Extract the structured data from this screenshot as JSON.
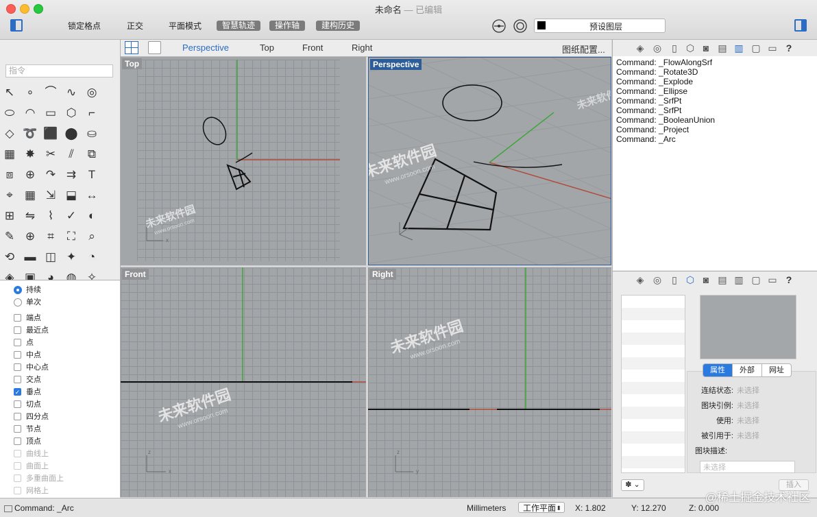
{
  "window": {
    "title": "未命名",
    "subtitle": "— 已编辑"
  },
  "toolbar": {
    "buttons": [
      "锁定格点",
      "正交",
      "平面模式"
    ],
    "pills": [
      "智慧轨迹",
      "操作轴",
      "建构历史"
    ],
    "layer_label": "预设图层"
  },
  "left": {
    "command_placeholder": "指令",
    "tools": [
      "select-icon",
      "point-icon",
      "polyline-icon",
      "curve-icon",
      "circle-icon",
      "ellipse-icon",
      "arc-icon",
      "rectangle-icon",
      "polygon-icon",
      "fillet-icon",
      "surface-icon",
      "sweep-icon",
      "box-icon",
      "sphere-icon",
      "cylinder-icon",
      "mesh-icon",
      "explode-icon",
      "trim-icon",
      "split-icon",
      "join-icon",
      "group-icon",
      "boolean-icon",
      "curve-fillet-icon",
      "offset-icon",
      "text-icon",
      "snap-icon",
      "array-icon",
      "transform-icon",
      "extrude-icon",
      "dimension-icon",
      "grid-icon",
      "mirror-icon",
      "deform-icon",
      "check-icon",
      "shade-icon",
      "paint-icon",
      "zoom-in-icon",
      "zoom-window-icon",
      "zoom-extents-icon",
      "zoom-icon",
      "rotate-view-icon",
      "car-icon",
      "layout-icon",
      "lighting-icon",
      "bulb-icon",
      "render-icon",
      "material-icon",
      "color-icon",
      "globe-icon",
      "lamp-icon"
    ],
    "snap_modes": [
      {
        "label": "持续",
        "checked": true
      },
      {
        "label": "单次",
        "checked": false
      }
    ],
    "osnaps": [
      {
        "label": "端点",
        "checked": false,
        "enabled": true
      },
      {
        "label": "最近点",
        "checked": false,
        "enabled": true
      },
      {
        "label": "点",
        "checked": false,
        "enabled": true
      },
      {
        "label": "中点",
        "checked": false,
        "enabled": true
      },
      {
        "label": "中心点",
        "checked": false,
        "enabled": true
      },
      {
        "label": "交点",
        "checked": false,
        "enabled": true
      },
      {
        "label": "垂点",
        "checked": true,
        "enabled": true
      },
      {
        "label": "切点",
        "checked": false,
        "enabled": true
      },
      {
        "label": "四分点",
        "checked": false,
        "enabled": true
      },
      {
        "label": "节点",
        "checked": false,
        "enabled": true
      },
      {
        "label": "顶点",
        "checked": false,
        "enabled": true
      },
      {
        "label": "曲线上",
        "checked": false,
        "enabled": false
      },
      {
        "label": "曲面上",
        "checked": false,
        "enabled": false
      },
      {
        "label": "多重曲面上",
        "checked": false,
        "enabled": false
      },
      {
        "label": "网格上",
        "checked": false,
        "enabled": false
      }
    ]
  },
  "viewport_tabs": {
    "tabs": [
      "Perspective",
      "Top",
      "Front",
      "Right"
    ],
    "active": "Perspective",
    "layout_button": "图纸配置..."
  },
  "viewports": {
    "top": "Top",
    "perspective": "Perspective",
    "front": "Front",
    "right": "Right"
  },
  "watermark": {
    "brand": "未来软件园",
    "url": "www.orsoon.com"
  },
  "command_history": [
    "Command: _FlowAlongSrf",
    "Command: _Rotate3D",
    "Command: _Explode",
    "Command: _Ellipse",
    "Command: _SrfPt",
    "Command: _SrfPt",
    "Command: _BooleanUnion",
    "Command: _Project",
    "Command: _Arc"
  ],
  "properties": {
    "tabs": [
      "属性",
      "外部",
      "网址"
    ],
    "active_tab": "属性",
    "rows": [
      {
        "key": "连结状态:",
        "value": "未选择"
      },
      {
        "key": "图块引例:",
        "value": "未选择"
      },
      {
        "key": "使用:",
        "value": "未选择"
      },
      {
        "key": "被引用于:",
        "value": "未选择"
      }
    ],
    "desc_label": "图块描述:",
    "desc_placeholder": "未选择",
    "insert_button": "插入",
    "gear_button": "✽ ⌄"
  },
  "status": {
    "last_command": "Command: _Arc",
    "units": "Millimeters",
    "cplane": "工作平面",
    "x": "X: 1.802",
    "y": "Y: 12.270",
    "z": "Z: 0.000"
  },
  "corner_watermark": "@稀土掘金技术社区",
  "colors": {
    "accent": "#2b6cc4",
    "axis_x": "#b04a3c",
    "axis_y": "#3ea53a",
    "active_viewport_label": "#2c5d99"
  }
}
